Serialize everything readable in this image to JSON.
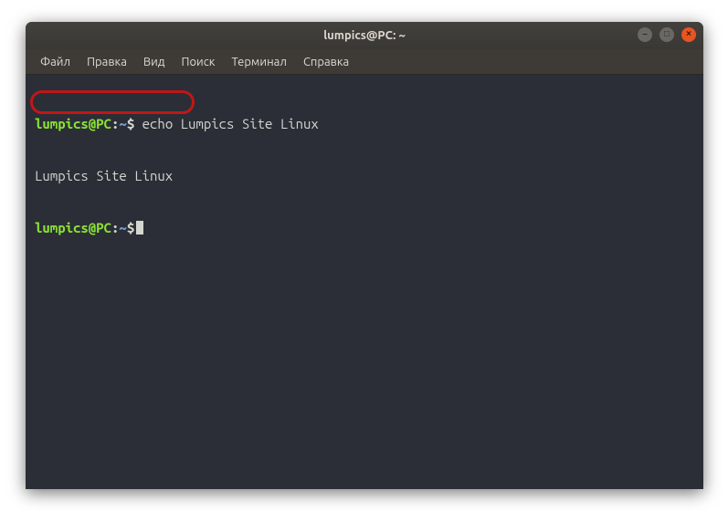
{
  "window": {
    "title": "lumpics@PC: ~"
  },
  "menu": {
    "file": "Файл",
    "edit": "Правка",
    "view": "Вид",
    "search": "Поиск",
    "term": "Терминал",
    "help": "Справка"
  },
  "prompt": {
    "userhost": "lumpics@PC",
    "colon": ":",
    "path": "~",
    "sigil": "$"
  },
  "lines": {
    "cmd1": " echo Lumpics Site Linux",
    "output": "Lumpics Site Linux"
  },
  "icons": {
    "min": "–",
    "max": "□",
    "close": "×"
  },
  "colors": {
    "accent": "#e95420",
    "prompt_green": "#8ae234",
    "highlight": "#c11717"
  }
}
